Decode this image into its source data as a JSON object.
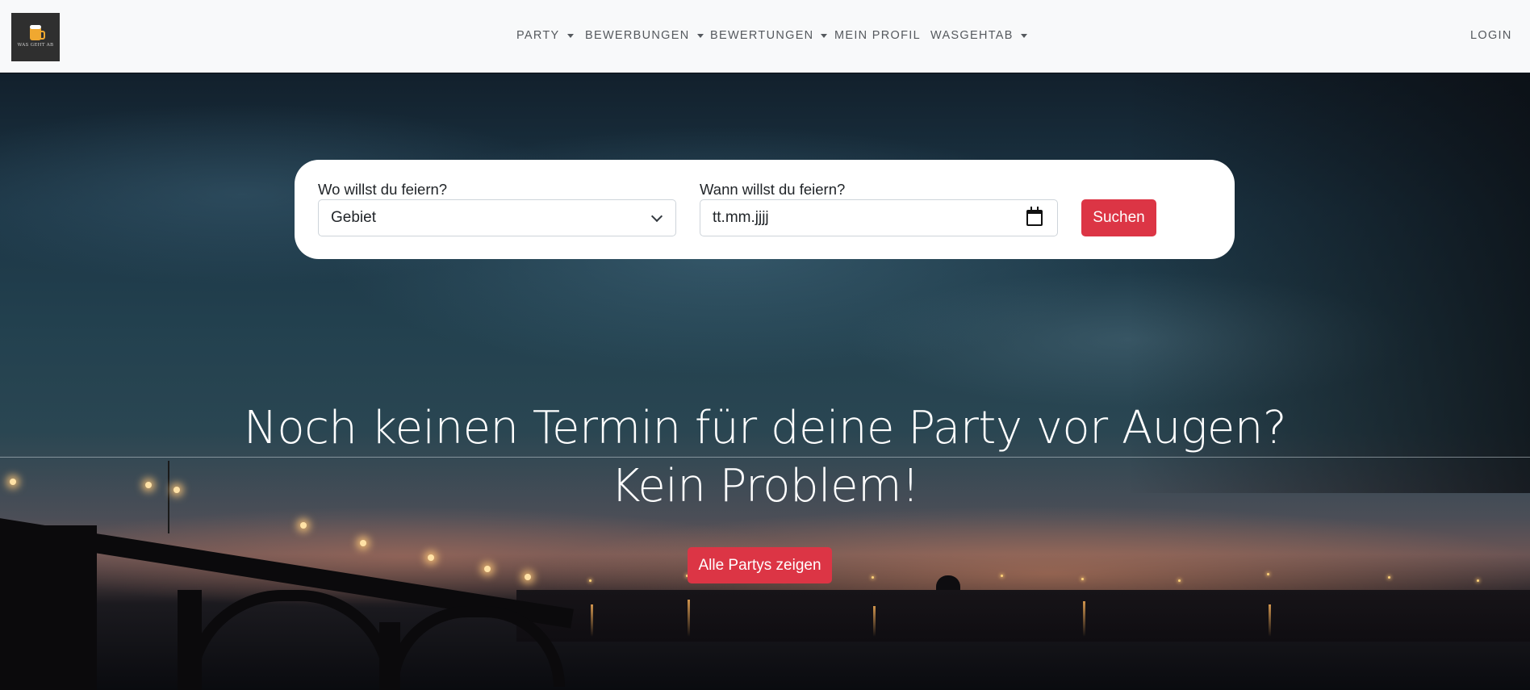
{
  "logo": {
    "alt_text": "WAS GEHT AB"
  },
  "nav": {
    "items": [
      {
        "label": "PARTY",
        "dropdown": true
      },
      {
        "label": "BEWERBUNGEN",
        "dropdown": true
      },
      {
        "label": "BEWERTUNGEN",
        "dropdown": true
      },
      {
        "label": "MEIN PROFIL",
        "dropdown": false
      },
      {
        "label": "WASGEHTAB",
        "dropdown": true
      }
    ],
    "login_label": "LOGIN"
  },
  "search": {
    "location_label": "Wo willst du feiern?",
    "location_value": "Gebiet",
    "date_label": "Wann willst du feiern?",
    "date_placeholder": "tt.mm.jjjj",
    "submit_label": "Suchen"
  },
  "hero": {
    "headline_line1": "Noch keinen Termin für deine Party vor Augen?",
    "headline_line2": "Kein Problem!",
    "cta_label": "Alle Partys zeigen"
  },
  "colors": {
    "accent": "#dc3545",
    "navbar_bg": "#f8f9fa",
    "nav_text": "#55595e"
  },
  "icons": [
    "beer-mug-logo-icon",
    "caret-down-icon",
    "chevron-down-icon",
    "calendar-icon"
  ]
}
